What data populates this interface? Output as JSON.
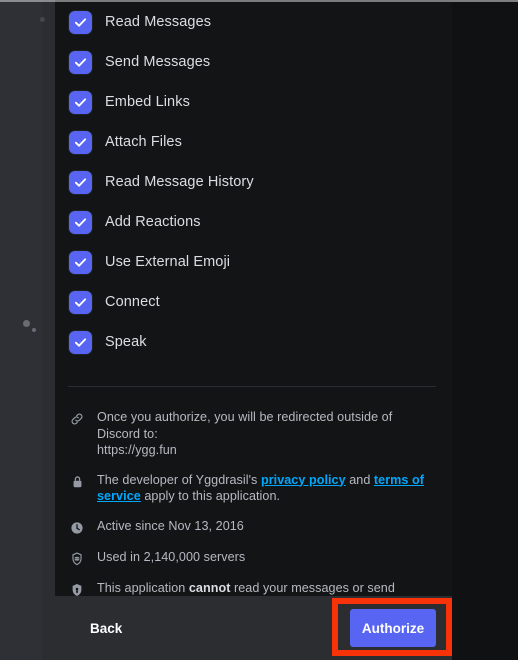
{
  "dialog": {
    "name": "discord-oauth-authorize",
    "permissions_header_visible": false,
    "permissions": [
      {
        "label": "Read Messages",
        "checked": true
      },
      {
        "label": "Send Messages",
        "checked": true
      },
      {
        "label": "Embed Links",
        "checked": true
      },
      {
        "label": "Attach Files",
        "checked": true
      },
      {
        "label": "Read Message History",
        "checked": true
      },
      {
        "label": "Add Reactions",
        "checked": true
      },
      {
        "label": "Use External Emoji",
        "checked": true
      },
      {
        "label": "Connect",
        "checked": true
      },
      {
        "label": "Speak",
        "checked": true
      }
    ],
    "info": [
      {
        "icon": "link-icon",
        "line1": "Once you authorize, you will be redirected outside of Discord to:",
        "line2": "https://ygg.fun"
      },
      {
        "icon": "lock-icon",
        "prefix": "The developer of Yggdrasil's ",
        "link1": "privacy policy",
        "middle": " and ",
        "link2": "terms of service",
        "suffix": " apply to this application."
      },
      {
        "icon": "clock-icon",
        "text": "Active since Nov 13, 2016"
      },
      {
        "icon": "bot-server-icon",
        "text": "Used in 2,140,000 servers"
      },
      {
        "icon": "shield-icon",
        "prefix": "This application ",
        "bold": "cannot",
        "suffix": " read your messages or send messages as you."
      }
    ],
    "footer": {
      "back_label": "Back",
      "authorize_label": "Authorize"
    },
    "colors": {
      "accent_blurple": "#5865F2",
      "link_blue": "#00A8FC",
      "annotation_red": "#F8330A",
      "modal_bg": "#131416",
      "footer_bg": "#2B2D31"
    }
  }
}
